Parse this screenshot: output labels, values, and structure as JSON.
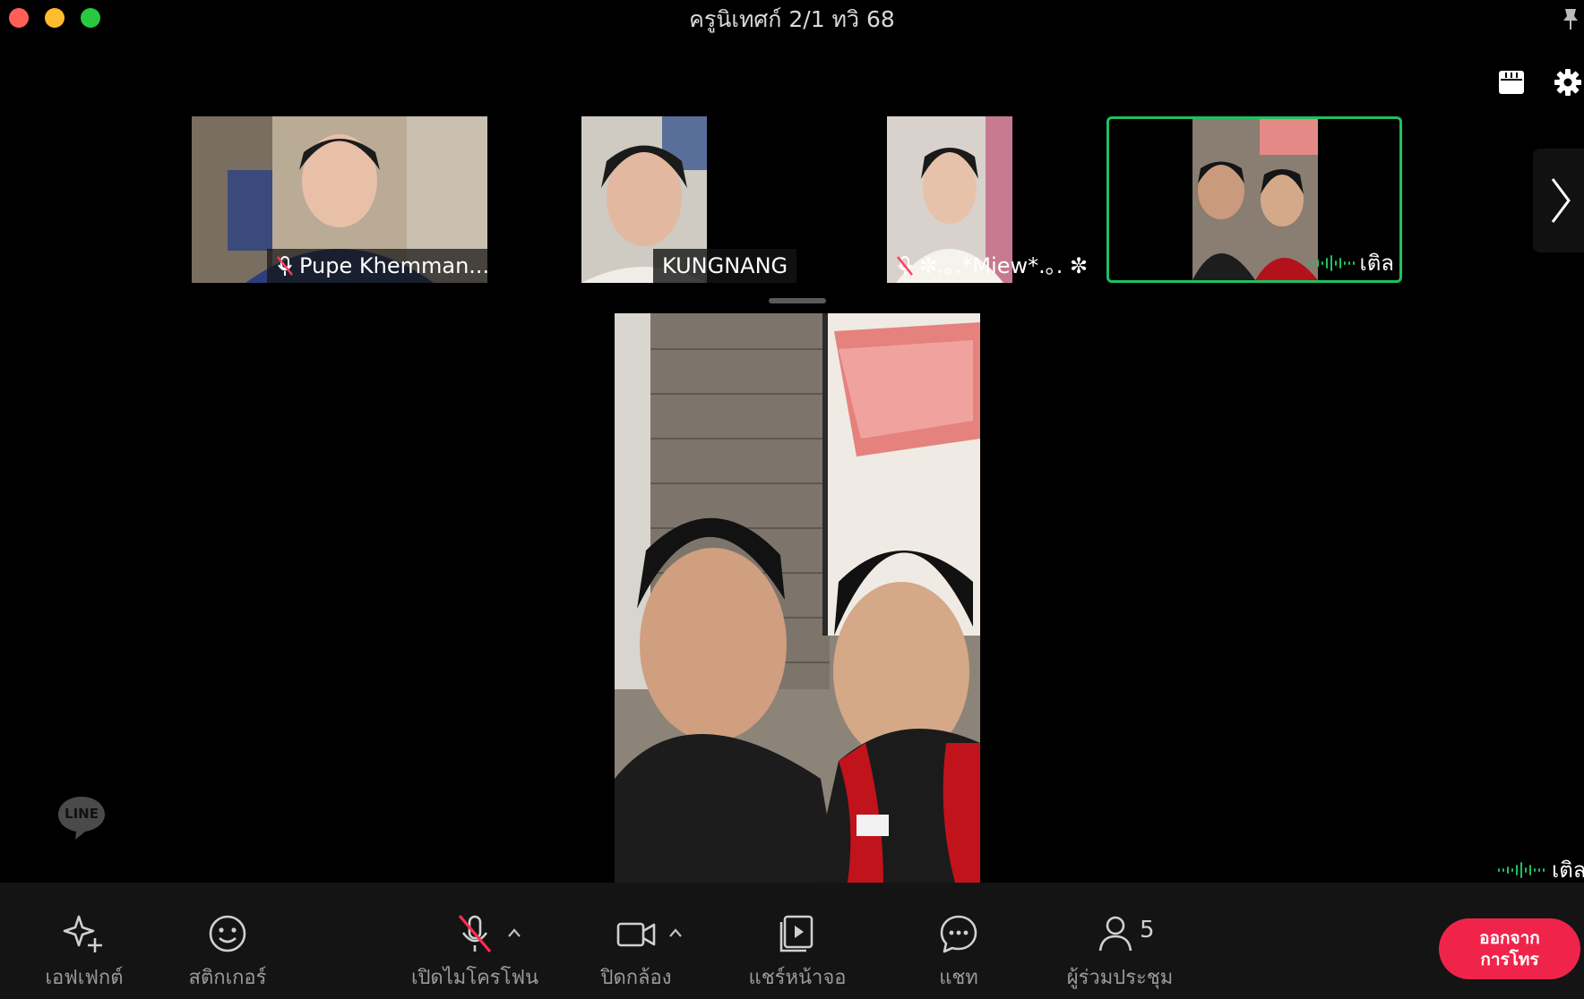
{
  "window": {
    "title": "ครูนิเทศก์ 2/1 ทวิ 68",
    "traffic_colors": [
      "#ff5f57",
      "#febc2e",
      "#28c840"
    ]
  },
  "top_icons": [
    "grid-icon",
    "gear-icon",
    "pin-icon"
  ],
  "participants": [
    {
      "name": "Pupe Khemman...",
      "muted": true,
      "speaking": false
    },
    {
      "name": "KUNGNANG",
      "muted": false,
      "speaking": false
    },
    {
      "name": "✼.｡.*Miew*.｡. ✼",
      "muted": true,
      "speaking": false
    },
    {
      "name": "เติล",
      "muted": false,
      "speaking": true,
      "active": true
    }
  ],
  "main_speaker": {
    "name": "เติล"
  },
  "logo": "LINE",
  "toolbar": {
    "effects": "เอฟเฟกต์",
    "stickers": "สติกเกอร์",
    "mic": "เปิดไมโครโฟน",
    "camera": "ปิดกล้อง",
    "share": "แชร์หน้าจอ",
    "chat": "แชท",
    "participants": "ผู้ร่วมประชุม",
    "participant_count": "5",
    "leave_line1": "ออกจาก",
    "leave_line2": "การโทร"
  },
  "colors": {
    "accent_green": "#20c060",
    "leave_red": "#f0244a",
    "toolbar_bg": "#141414",
    "icon_gray": "#9a9a9a"
  }
}
